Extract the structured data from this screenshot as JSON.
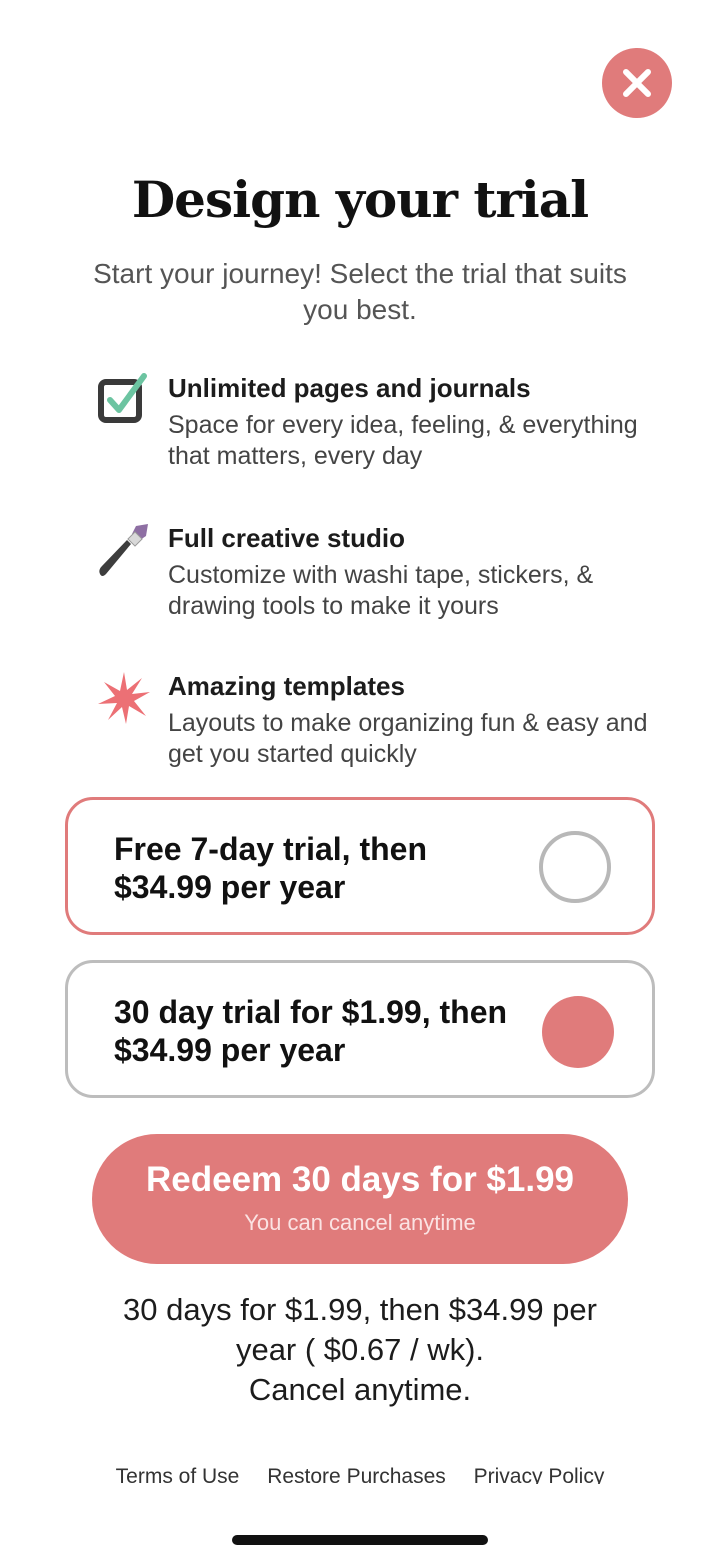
{
  "header": {
    "title": "Design your trial",
    "subtitle": "Start your journey! Select the trial that suits you best.",
    "close_icon": "close-x-icon"
  },
  "features": [
    {
      "icon": "checkbox-icon",
      "title": "Unlimited pages and journals",
      "description": "Space for every idea, feeling, & everything that matters, every day"
    },
    {
      "icon": "paintbrush-icon",
      "title": "Full creative studio",
      "description": "Customize with washi tape, stickers, & drawing tools to make it yours"
    },
    {
      "icon": "starburst-icon",
      "title": "Amazing templates",
      "description": "Layouts to make organizing fun & easy and get you started quickly"
    }
  ],
  "plans": [
    {
      "label": "Free 7-day trial, then $34.99 per year",
      "selected": false
    },
    {
      "label": "30 day trial for $1.99, then $34.99 per year",
      "selected": true
    }
  ],
  "cta": {
    "main": "Redeem 30 days for $1.99",
    "sub": "You can cancel anytime"
  },
  "price_note": {
    "line1": "30 days for $1.99, then $34.99 per",
    "line2": "year ( $0.67 / wk).",
    "line3": "Cancel anytime."
  },
  "footer": {
    "terms": "Terms of Use",
    "restore": "Restore Purchases",
    "privacy": "Privacy Policy"
  },
  "colors": {
    "accent": "#e07b7b",
    "unselected_border": "#bdbdbd",
    "check_green": "#6cc4a1",
    "brush_purple": "#8e6fa3"
  }
}
